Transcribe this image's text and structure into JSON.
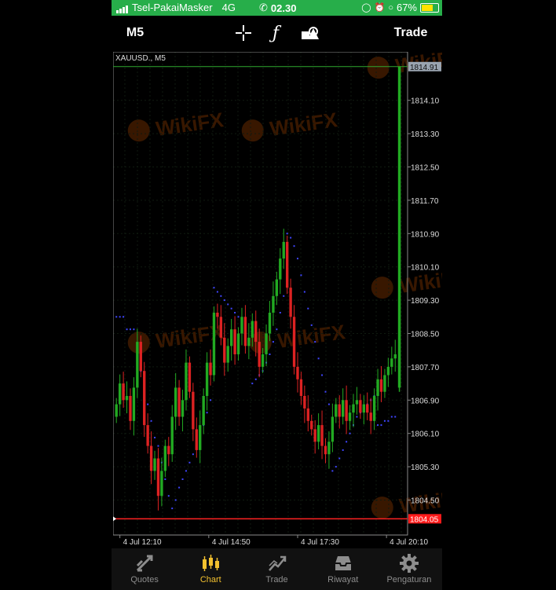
{
  "status": {
    "carrier": "Tsel-PakaiMasker",
    "network": "4G",
    "time": "02.30",
    "battery": "67%"
  },
  "toolbar": {
    "timeframe": "M5",
    "trade_label": "Trade"
  },
  "chart_data": {
    "type": "candlestick",
    "symbol_label": "XAUUSD., M5",
    "ylim": [
      1804.0,
      1815.0
    ],
    "y_ticks": [
      "1814.10",
      "1813.30",
      "1812.50",
      "1811.70",
      "1810.90",
      "1810.10",
      "1809.30",
      "1808.50",
      "1807.70",
      "1806.90",
      "1806.10",
      "1805.30",
      "1804.50"
    ],
    "x_ticks": [
      "4 Jul 12:10",
      "4 Jul 14:50",
      "4 Jul 17:30",
      "4 Jul 20:10"
    ],
    "bid_label": "1814.91",
    "ask_label": "1804.05",
    "bid_line_color": "#2fa82f",
    "ask_line_color": "#ff2222",
    "bull_color": "#22aa22",
    "bear_color": "#dd2222",
    "sar_color": "#3f45ff",
    "closes": [
      1806.8,
      1807.3,
      1806.9,
      1807.0,
      1806.4,
      1807.2,
      1808.3,
      1807.6,
      1806.3,
      1805.8,
      1805.2,
      1805.5,
      1804.6,
      1805.2,
      1805.8,
      1805.6,
      1806.5,
      1807.2,
      1806.5,
      1806.9,
      1807.8,
      1807.1,
      1806.2,
      1805.7,
      1806.3,
      1807.0,
      1807.8,
      1807.5,
      1809.0,
      1808.9,
      1808.4,
      1807.8,
      1808.2,
      1808.6,
      1808.0,
      1808.5,
      1808.9,
      1808.2,
      1808.4,
      1808.8,
      1808.3,
      1807.7,
      1808.0,
      1808.5,
      1809.0,
      1809.4,
      1809.8,
      1810.3,
      1810.7,
      1809.6,
      1808.9,
      1807.7,
      1807.4,
      1807.0,
      1806.7,
      1806.4,
      1806.2,
      1805.9,
      1806.3,
      1805.8,
      1805.6,
      1805.9,
      1806.5,
      1806.8,
      1806.5,
      1806.9,
      1806.4,
      1806.6,
      1806.8,
      1806.9,
      1806.6,
      1806.8,
      1806.6,
      1806.4,
      1807.0,
      1807.4,
      1807.1,
      1807.5,
      1807.7,
      1807.9,
      1808.0
    ],
    "sar": [
      1808.9,
      1808.9,
      1808.9,
      1808.6,
      1808.6,
      1808.6,
      1808.0,
      1807.6,
      1807.2,
      1806.8,
      1806.4,
      1806.0,
      1805.8,
      1805.4,
      1805.0,
      1804.6,
      1804.3,
      1804.5,
      1804.8,
      1805.0,
      1805.2,
      1805.4,
      1805.6,
      1805.8,
      1806.0,
      1806.3,
      1806.6,
      1806.9,
      1809.6,
      1809.5,
      1809.4,
      1809.3,
      1809.2,
      1809.1,
      1809.0,
      1808.9,
      1808.7,
      1808.5,
      1808.3,
      1807.3,
      1807.4,
      1807.5,
      1807.6,
      1807.8,
      1808.0,
      1808.3,
      1808.6,
      1809.0,
      1809.4,
      1810.9,
      1810.8,
      1810.6,
      1810.3,
      1809.9,
      1809.5,
      1809.1,
      1808.7,
      1808.3,
      1807.9,
      1807.5,
      1807.1,
      1806.8,
      1805.2,
      1805.3,
      1805.5,
      1805.7,
      1805.9,
      1806.1,
      1806.3,
      1806.5,
      1806.6,
      1806.7,
      1806.8,
      1806.9,
      1807.0,
      1806.3,
      1806.3,
      1806.4,
      1806.4,
      1806.5,
      1806.5
    ],
    "last_bar": {
      "open": 1807.2,
      "high": 1814.91,
      "low": 1807.1,
      "close": 1814.91
    }
  },
  "watermark": {
    "text": "WikiFX"
  },
  "tabs": [
    {
      "label": "Quotes",
      "icon": "quotes-icon"
    },
    {
      "label": "Chart",
      "icon": "chart-icon",
      "active": true
    },
    {
      "label": "Trade",
      "icon": "trade-icon"
    },
    {
      "label": "Riwayat",
      "icon": "history-icon"
    },
    {
      "label": "Pengaturan",
      "icon": "settings-icon"
    }
  ]
}
